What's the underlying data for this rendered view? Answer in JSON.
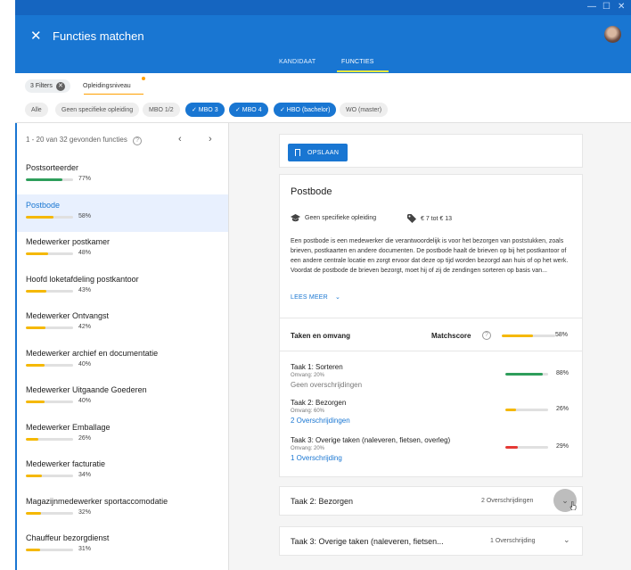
{
  "window": {
    "controls": [
      "—",
      "☐",
      "✕"
    ],
    "title": "Functies matchen",
    "close_icon": "close-icon"
  },
  "tabs": [
    {
      "label": "KANDIDAAT",
      "active": false
    },
    {
      "label": "FUNCTIES",
      "active": true
    }
  ],
  "filters": {
    "filters_label": "3 Filters",
    "level_label": "Opleidingsniveau",
    "chips": [
      {
        "label": "Alle",
        "selected": false
      },
      {
        "label": "Geen specifieke opleiding",
        "selected": false
      },
      {
        "label": "MBO 1/2",
        "selected": false
      },
      {
        "label": "✓ MBO 3",
        "selected": true
      },
      {
        "label": "✓ MBO 4",
        "selected": true
      },
      {
        "label": "✓ HBO (bachelor)",
        "selected": true
      },
      {
        "label": "WO (master)",
        "selected": false
      }
    ]
  },
  "results": {
    "count_text": "1 - 20 van 32 gevonden functies",
    "prev": "‹",
    "next": "›",
    "jobs": [
      {
        "title": "Postsorteerder",
        "score": 77,
        "pct": "77%",
        "color": "#2e9e5b",
        "selected": false
      },
      {
        "title": "Postbode",
        "score": 58,
        "pct": "58%",
        "color": "#f5b800",
        "selected": true
      },
      {
        "title": "Medewerker postkamer",
        "score": 48,
        "pct": "48%",
        "color": "#f5b800",
        "selected": false
      },
      {
        "title": "Hoofd loketafdeling postkantoor",
        "score": 43,
        "pct": "43%",
        "color": "#f5b800",
        "selected": false
      },
      {
        "title": "Medewerker Ontvangst",
        "score": 42,
        "pct": "42%",
        "color": "#f5b800",
        "selected": false
      },
      {
        "title": "Medewerker archief en documentatie",
        "score": 40,
        "pct": "40%",
        "color": "#f5b800",
        "selected": false
      },
      {
        "title": "Medewerker Uitgaande Goederen",
        "score": 40,
        "pct": "40%",
        "color": "#f5b800",
        "selected": false
      },
      {
        "title": "Medewerker Emballage",
        "score": 26,
        "pct": "26%",
        "color": "#f5b800",
        "selected": false
      },
      {
        "title": "Medewerker facturatie",
        "score": 34,
        "pct": "34%",
        "color": "#f5b800",
        "selected": false
      },
      {
        "title": "Magazijnmedewerker sportaccomodatie",
        "score": 32,
        "pct": "32%",
        "color": "#f5b800",
        "selected": false
      },
      {
        "title": "Chauffeur bezorgdienst",
        "score": 31,
        "pct": "31%",
        "color": "#f5b800",
        "selected": false
      }
    ]
  },
  "detail": {
    "save_label": "OPSLAAN",
    "title": "Postbode",
    "education": "Geen specifieke opleiding",
    "salary": "€ 7 tot € 13",
    "description": "Een postbode is een medewerker die verantwoordelijk is voor het bezorgen van poststukken, zoals brieven, postkaarten en andere documenten. De postbode haalt de brieven op bij het postkantoor of een andere centrale locatie en zorgt ervoor dat deze op tijd worden bezorgd aan huis of op het werk. Voordat de postbode de brieven bezorgt, moet hij of zij de zendingen sorteren op basis van...",
    "read_more": "LEES MEER",
    "section_title": "Taken en omvang",
    "matchscore_label": "Matchscore",
    "matchscore": 58,
    "matchscore_pct": "58%",
    "tasks": [
      {
        "title": "Taak 1: Sorteren",
        "omvang": "Omvang: 20%",
        "overschrijding": "Geen overschrijdingen",
        "link": false,
        "score": 88,
        "pct": "88%",
        "color": "#2e9e5b"
      },
      {
        "title": "Taak 2: Bezorgen",
        "omvang": "Omvang: 60%",
        "overschrijding": "2 Overschrijdingen",
        "link": true,
        "score": 26,
        "pct": "26%",
        "color": "#f5b800"
      },
      {
        "title": "Taak 3: Overige taken (naleveren, fietsen, overleg)",
        "omvang": "Omvang: 20%",
        "overschrijding": "1 Overschrijding",
        "link": true,
        "score": 29,
        "pct": "29%",
        "color": "#e53935"
      }
    ]
  },
  "accordions": [
    {
      "title": "Taak 2: Bezorgen",
      "count": "2 Overschrijdingen"
    },
    {
      "title": "Taak 3: Overige taken (naleveren, fietsen...",
      "count": "1 Overschrijding"
    }
  ]
}
